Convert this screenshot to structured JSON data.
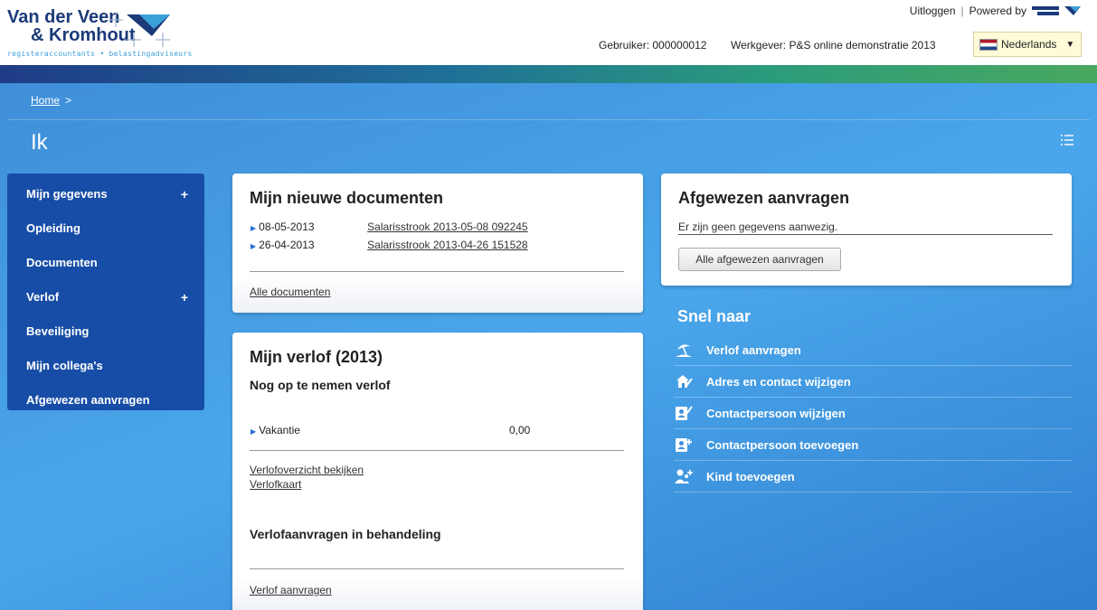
{
  "header": {
    "logo_line1": "Van der Veen",
    "logo_line2": "& Kromhout",
    "logo_sub": "registeraccountants • belastingadviseurs",
    "logout": "Uitloggen",
    "separator": "|",
    "powered_by": "Powered by",
    "user": "Gebruiker: 000000012",
    "employer": "Werkgever: P&S online demonstratie 2013",
    "language": "Nederlands"
  },
  "breadcrumb": {
    "home": "Home",
    "sep": ">"
  },
  "page_title": "Ik",
  "sidebar": {
    "items": [
      {
        "label": "Mijn gegevens",
        "expand": "+"
      },
      {
        "label": "Opleiding",
        "expand": ""
      },
      {
        "label": "Documenten",
        "expand": ""
      },
      {
        "label": "Verlof",
        "expand": "+"
      },
      {
        "label": "Beveiliging",
        "expand": ""
      },
      {
        "label": "Mijn collega's",
        "expand": ""
      },
      {
        "label": "Afgewezen aanvragen",
        "expand": ""
      }
    ]
  },
  "documents": {
    "title": "Mijn nieuwe documenten",
    "rows": [
      {
        "date": "08-05-2013",
        "name": "Salarisstrook 2013-05-08 092245"
      },
      {
        "date": "26-04-2013",
        "name": "Salarisstrook 2013-04-26 151528"
      }
    ],
    "all_link": "Alle documenten"
  },
  "verlof": {
    "title": "Mijn verlof (2013)",
    "subtitle": "Nog op te nemen verlof",
    "type": "Vakantie",
    "value": "0,00",
    "overview_link": "Verlofoverzicht bekijken",
    "card_link": "Verlofkaart",
    "pending_title": "Verlofaanvragen in behandeling",
    "request_link": "Verlof aanvragen"
  },
  "rejected": {
    "title": "Afgewezen aanvragen",
    "message": "Er zijn geen gegevens aanwezig.",
    "button": "Alle afgewezen aanvragen"
  },
  "quick": {
    "title": "Snel naar",
    "items": [
      {
        "label": "Verlof aanvragen",
        "icon": "beach-umbrella-icon"
      },
      {
        "label": "Adres en contact wijzigen",
        "icon": "house-edit-icon"
      },
      {
        "label": "Contactpersoon wijzigen",
        "icon": "contact-edit-icon"
      },
      {
        "label": "Contactpersoon toevoegen",
        "icon": "contact-add-icon"
      },
      {
        "label": "Kind toevoegen",
        "icon": "child-add-icon"
      }
    ]
  }
}
